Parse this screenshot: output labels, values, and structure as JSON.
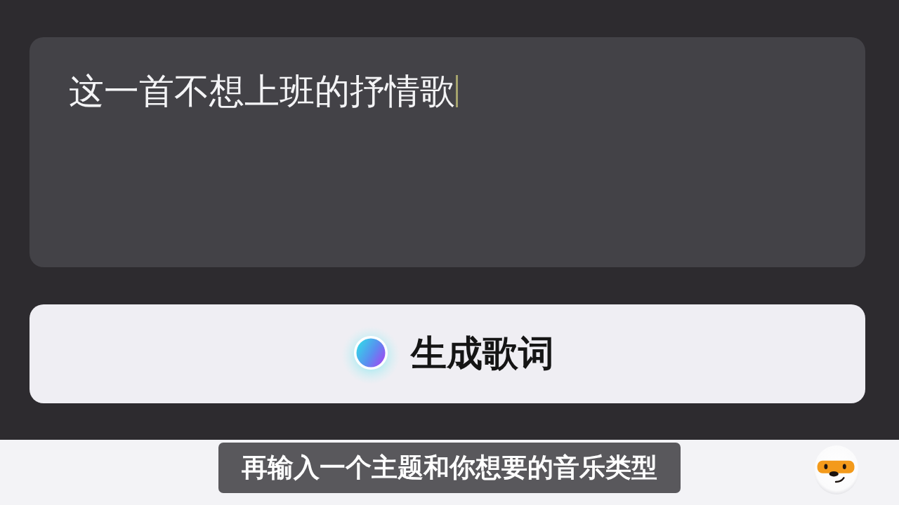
{
  "lyrics_input": {
    "value": "这一首不想上班的抒情歌",
    "focused": true
  },
  "generate_button": {
    "label": "生成歌词"
  },
  "subtitle": {
    "text": "再输入一个主题和你想要的音乐类型"
  }
}
